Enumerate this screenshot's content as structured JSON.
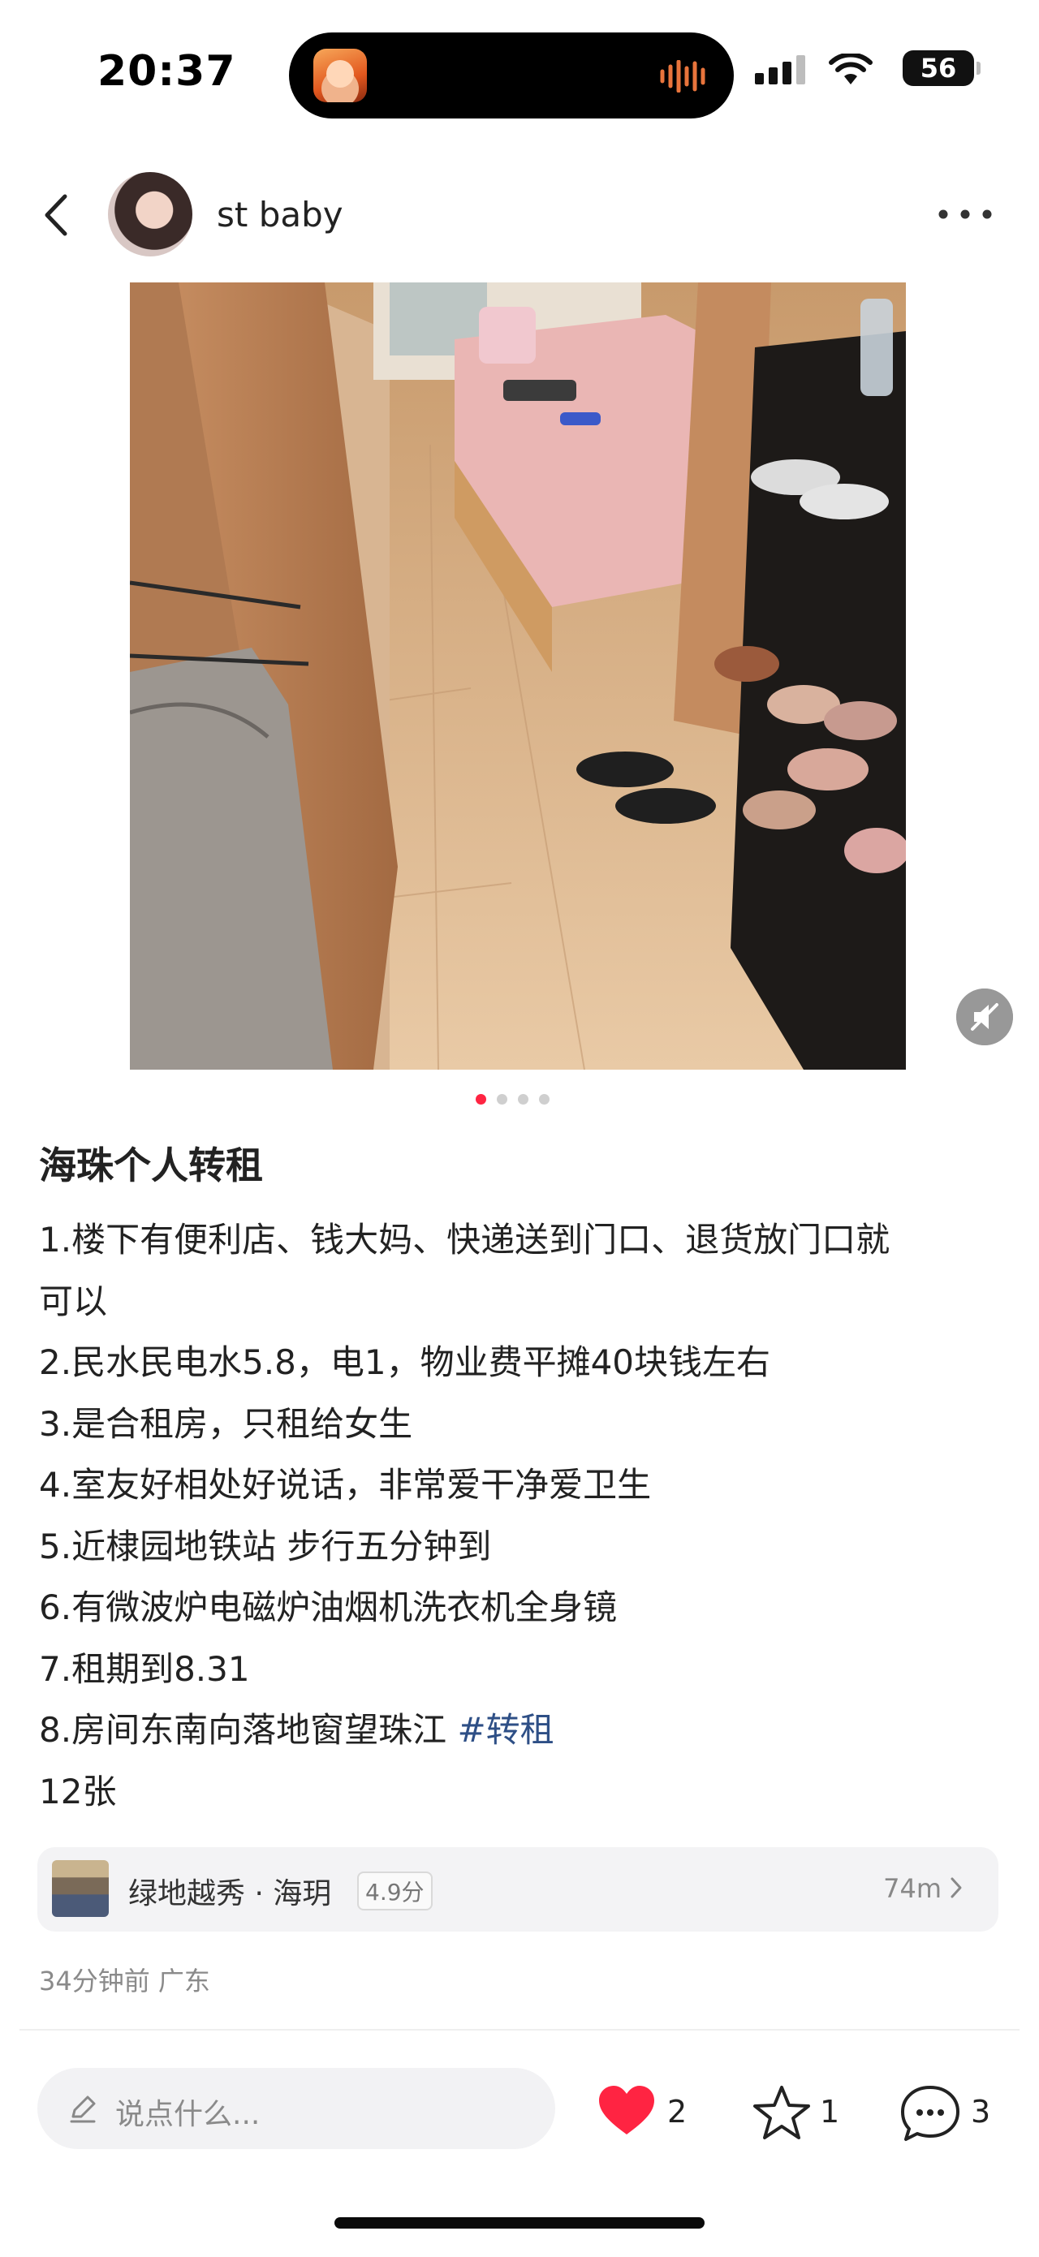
{
  "status_bar": {
    "time": "20:37",
    "battery": "56"
  },
  "post": {
    "username": "st baby",
    "title": "海珠个人转租",
    "lines": [
      "1.楼下有便利店、钱大妈、快递送到门口、退货放门口就",
      "可以",
      "2.民水民电水5.8，电1，物业费平摊40块钱左右",
      "3.是合租房，只租给女生",
      "4.室友好相处好说话，非常爱干净爱卫生",
      "5.近棣园地铁站 步行五分钟到",
      "6.有微波炉电磁炉油烟机洗衣机全身镜",
      "7.租期到8.31"
    ],
    "line8_text": "8.房间东南向落地窗望珠江 ",
    "hashtag": "#转租",
    "photo_count": "12张",
    "carousel_dots": 4,
    "active_dot": 0
  },
  "location": {
    "name": "绿地越秀 · 海玥",
    "rating": "4.9分",
    "distance": "74m"
  },
  "meta": "34分钟前 广东",
  "bottom_bar": {
    "comment_placeholder": "说点什么...",
    "likes": "2",
    "favorites": "1",
    "comments": "3"
  },
  "colors": {
    "accent": "#ff2442",
    "hashtag": "#2e4f86"
  }
}
